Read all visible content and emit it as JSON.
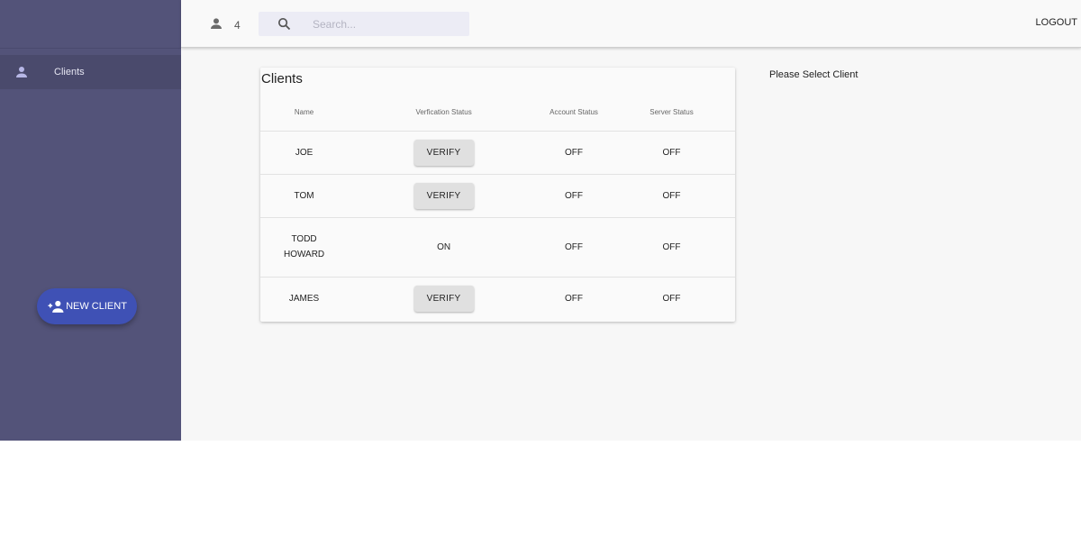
{
  "sidebar": {
    "items": [
      {
        "label": "Clients",
        "icon": "person-icon"
      }
    ],
    "new_client_label": "NEW CLIENT",
    "new_client_icon": "person-add-icon",
    "background": "#535379",
    "fab_color": "#3f51b5"
  },
  "topbar": {
    "user_count": "4",
    "user_icon": "person-icon",
    "search": {
      "placeholder": "Search...",
      "value": "",
      "icon": "search-icon"
    },
    "logout_label": "LOGOUT"
  },
  "clients_table": {
    "title": "Clients",
    "columns": [
      "Name",
      "Verfication Status",
      "Account Status",
      "Server Status"
    ],
    "rows": [
      {
        "name": "JOE",
        "verification": "VERIFY",
        "verification_is_button": true,
        "account": "OFF",
        "server": "OFF"
      },
      {
        "name": "TOM",
        "verification": "VERIFY",
        "verification_is_button": true,
        "account": "OFF",
        "server": "OFF"
      },
      {
        "name": "TODD HOWARD",
        "verification": "ON",
        "verification_is_button": false,
        "account": "OFF",
        "server": "OFF"
      },
      {
        "name": "JAMES",
        "verification": "VERIFY",
        "verification_is_button": true,
        "account": "OFF",
        "server": "OFF"
      }
    ]
  },
  "detail_panel": {
    "message": "Please Select Client"
  }
}
